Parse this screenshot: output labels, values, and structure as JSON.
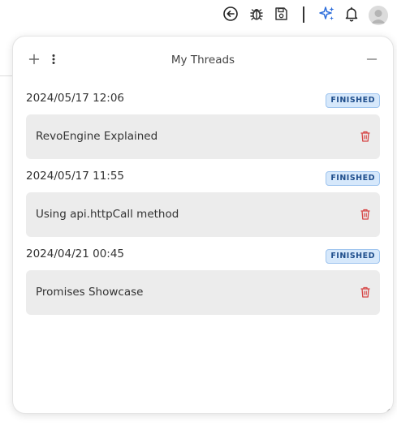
{
  "toolbar": {
    "icons": [
      "back-icon",
      "bug-icon",
      "save-icon",
      "sparkle-icon",
      "bell-icon",
      "avatar"
    ],
    "accent_color": "#2f6fdb"
  },
  "panel": {
    "title": "My Threads",
    "threads": [
      {
        "date": "2024/05/17 12:06",
        "status": "FINISHED",
        "title": "RevoEngine Explained"
      },
      {
        "date": "2024/05/17 11:55",
        "status": "FINISHED",
        "title": "Using api.httpCall method"
      },
      {
        "date": "2024/04/21 00:45",
        "status": "FINISHED",
        "title": "Promises Showcase"
      }
    ],
    "colors": {
      "badge_bg": "#d6e8fb",
      "badge_text": "#1f4e8c",
      "trash": "#d64545",
      "card_bg": "#ececec"
    }
  }
}
